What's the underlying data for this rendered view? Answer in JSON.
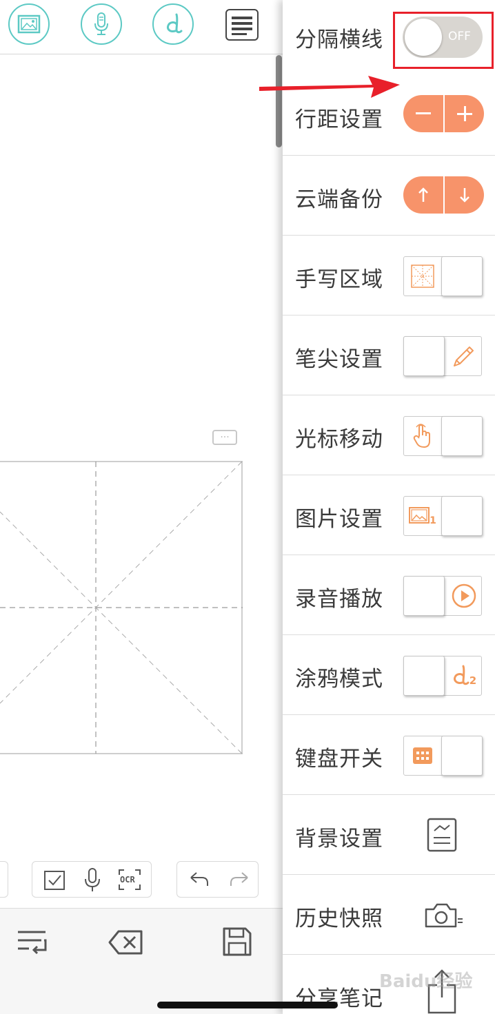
{
  "top_toolbar": {
    "buttons": [
      "image-icon",
      "microphone-icon",
      "handwriting-icon",
      "menu-icon"
    ]
  },
  "canvas": {
    "more_label": "···"
  },
  "edit_toolbar": {
    "ocr_label": "OCR"
  },
  "settings": {
    "divider_lines": {
      "label": "分隔横线",
      "toggle_text": "OFF"
    },
    "line_spacing": {
      "label": "行距设置"
    },
    "cloud_backup": {
      "label": "云端备份"
    },
    "handwriting_area": {
      "label": "手写区域"
    },
    "pen_tip": {
      "label": "笔尖设置"
    },
    "cursor_move": {
      "label": "光标移动"
    },
    "image_settings": {
      "label": "图片设置",
      "badge": "1"
    },
    "audio_playback": {
      "label": "录音播放"
    },
    "doodle_mode": {
      "label": "涂鸦模式",
      "badge": "2"
    },
    "keyboard_switch": {
      "label": "键盘开关"
    },
    "background_settings": {
      "label": "背景设置"
    },
    "history_snapshot": {
      "label": "历史快照"
    },
    "share_note": {
      "label": "分享笔记"
    }
  },
  "colors": {
    "accent_teal": "#5cc9c4",
    "accent_orange": "#f7936a",
    "highlight_red": "#e8202a"
  },
  "watermark": "Baidu经验"
}
